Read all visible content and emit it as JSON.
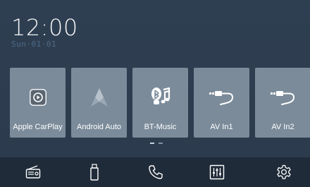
{
  "clock": {
    "time": "12:00",
    "date": "Sun·01·01"
  },
  "tiles": [
    {
      "label": "Apple CarPlay",
      "icon": "carplay-icon"
    },
    {
      "label": "Android Auto",
      "icon": "android-auto-icon"
    },
    {
      "label": "BT-Music",
      "icon": "bluetooth-music-icon"
    },
    {
      "label": "AV In1",
      "icon": "av-cable-icon"
    },
    {
      "label": "AV In2",
      "icon": "av-cable-icon"
    }
  ],
  "pager": {
    "pages": 2,
    "current": 1
  },
  "dock": [
    {
      "name": "radio-icon"
    },
    {
      "name": "usb-icon"
    },
    {
      "name": "phone-icon"
    },
    {
      "name": "equalizer-icon"
    },
    {
      "name": "settings-gear-icon"
    }
  ],
  "colors": {
    "background": "#2e3d4f",
    "tile": "#7b8b9a",
    "dock": "#1f2b38",
    "date_text": "#4e6a86"
  }
}
